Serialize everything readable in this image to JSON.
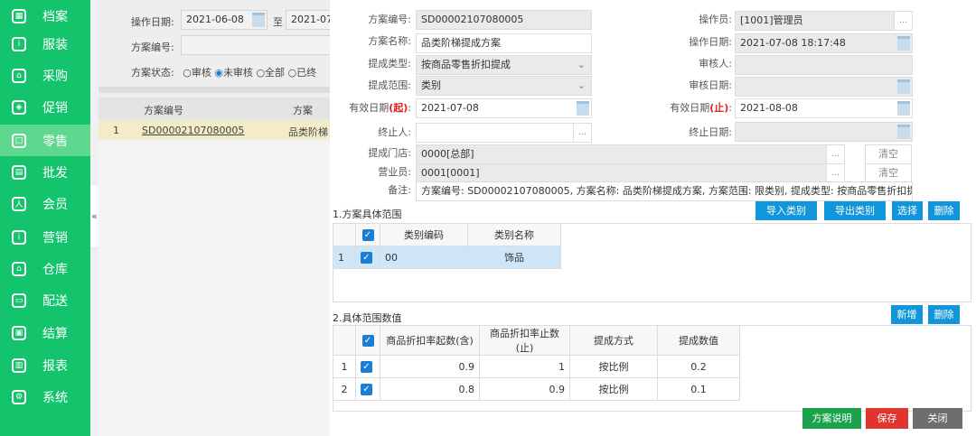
{
  "sidebar": {
    "items": [
      {
        "label": "档案",
        "icon": "archive-icon"
      },
      {
        "label": "服装",
        "icon": "info-icon"
      },
      {
        "label": "采购",
        "icon": "basket-icon"
      },
      {
        "label": "促销",
        "icon": "tag-icon"
      },
      {
        "label": "零售",
        "icon": "shopping-bag-icon",
        "active": true
      },
      {
        "label": "批发",
        "icon": "wholesale-icon"
      },
      {
        "label": "会员",
        "icon": "user-icon"
      },
      {
        "label": "营销",
        "icon": "info-icon"
      },
      {
        "label": "仓库",
        "icon": "warehouse-icon"
      },
      {
        "label": "配送",
        "icon": "truck-icon"
      },
      {
        "label": "结算",
        "icon": "settle-icon"
      },
      {
        "label": "报表",
        "icon": "chart-icon"
      },
      {
        "label": "系统",
        "icon": "gear-icon"
      }
    ],
    "collapse": "«"
  },
  "filter": {
    "date_label": "操作日期:",
    "date_from": "2021-06-08",
    "to": "至",
    "date_to": "2021-07",
    "code_label": "方案编号:",
    "status_label": "方案状态:",
    "status_options": [
      "审核",
      "未审核",
      "全部",
      "已终"
    ]
  },
  "grid": {
    "headers": [
      "方案编号",
      "方案"
    ],
    "rows": [
      {
        "num": "1",
        "code": "SD00002107080005",
        "name": "品类阶梯"
      }
    ]
  },
  "form": {
    "code_label": "方案编号:",
    "code": "SD00002107080005",
    "name_label": "方案名称:",
    "name": "品类阶梯提成方案",
    "type_label": "提成类型:",
    "type": "按商品零售折扣提成",
    "range_label": "提成范围:",
    "range": "类别",
    "valid_from_label": "有效日期",
    "from_mark": "(起)",
    "valid_from": "2021-07-08",
    "terminator_label": "终止人:",
    "store_label": "提成门店:",
    "store": "0000[总部]",
    "staff_label": "营业员:",
    "staff": "0001[0001]",
    "remark_label": "备注:",
    "remark": "方案编号: SD00002107080005, 方案名称: 品类阶梯提成方案, 方案范围: 限类别, 提成类型: 按商品零售折扣提成, 提",
    "operator_label": "操作员:",
    "operator": "[1001]管理员",
    "op_date_label": "操作日期:",
    "op_date": "2021-07-08 18:17:48",
    "auditor_label": "审核人:",
    "audit_date_label": "审核日期:",
    "valid_to_label": "有效日期",
    "to_mark": "(止)",
    "valid_to": "2021-08-08",
    "term_date_label": "终止日期:",
    "clear": "清空",
    "colon": ":"
  },
  "section1": {
    "title": "1.方案具体范围",
    "buttons": [
      "导入类别",
      "导出类别",
      "选择",
      "删除"
    ],
    "headers": [
      "类别编码",
      "类别名称"
    ],
    "rows": [
      {
        "num": "1",
        "code": "00",
        "name": "饰品"
      }
    ]
  },
  "section2": {
    "title": "2.具体范围数值",
    "buttons": [
      "新增",
      "删除"
    ],
    "headers": [
      "商品折扣率起数(含)",
      "商品折扣率止数(止)",
      "提成方式",
      "提成数值"
    ],
    "rows": [
      {
        "num": "1",
        "from": "0.9",
        "to": "1",
        "method": "按比例",
        "value": "0.2"
      },
      {
        "num": "2",
        "from": "0.8",
        "to": "0.9",
        "method": "按比例",
        "value": "0.1"
      }
    ]
  },
  "footer": {
    "explain": "方案说明",
    "save": "保存",
    "close": "关闭"
  }
}
